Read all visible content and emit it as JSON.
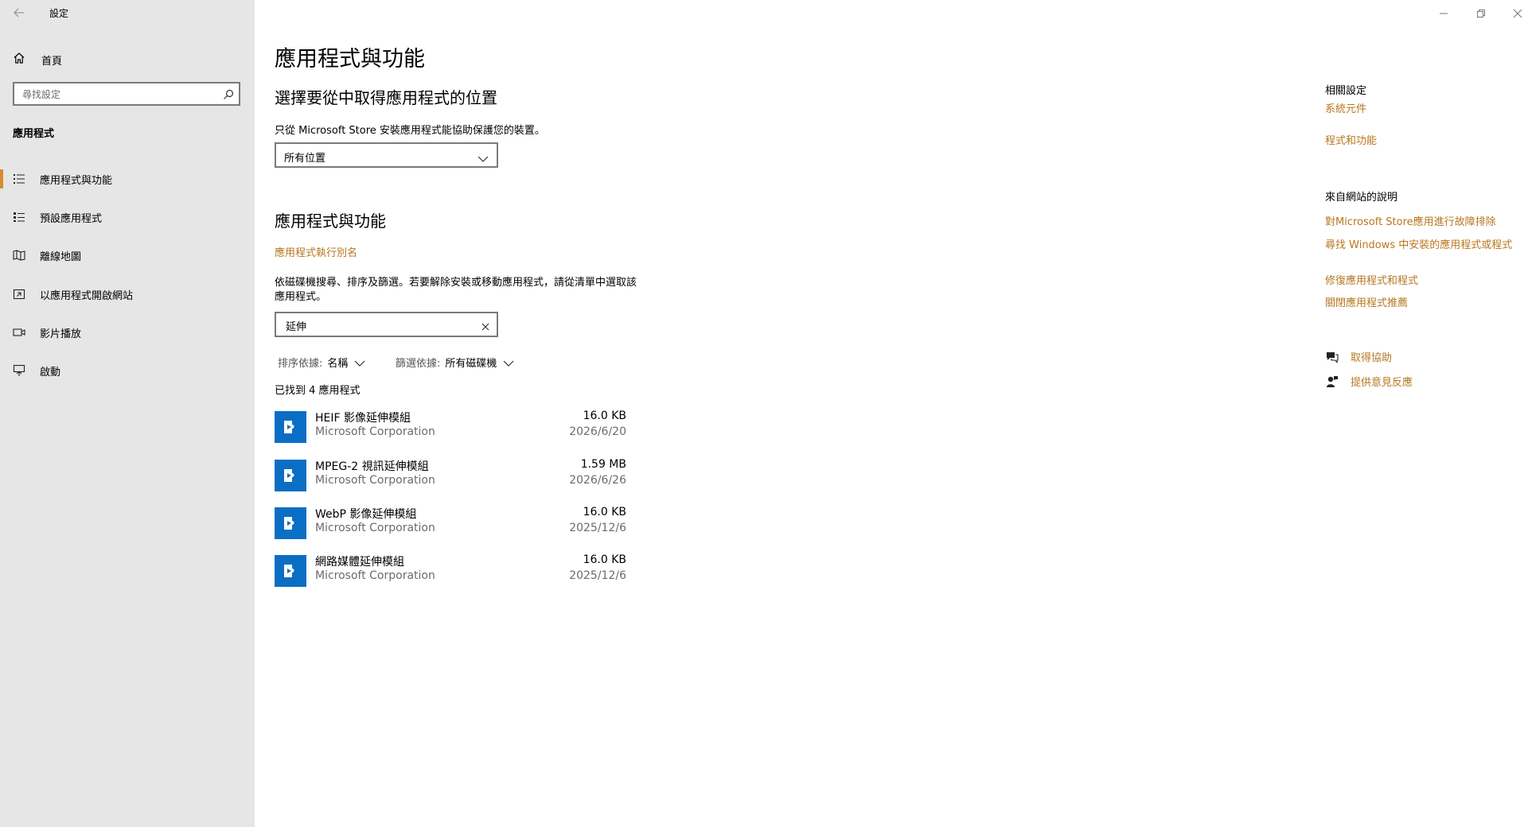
{
  "window": {
    "title": "設定"
  },
  "sidebar": {
    "home_label": "首頁",
    "search_placeholder": "尋找設定",
    "section_label": "應用程式",
    "items": [
      {
        "label": "應用程式與功能",
        "icon": "apps-features-icon",
        "selected": true
      },
      {
        "label": "預設應用程式",
        "icon": "default-apps-icon",
        "selected": false
      },
      {
        "label": "離線地圖",
        "icon": "offline-maps-icon",
        "selected": false
      },
      {
        "label": "以應用程式開啟網站",
        "icon": "apps-for-websites-icon",
        "selected": false
      },
      {
        "label": "影片播放",
        "icon": "video-playback-icon",
        "selected": false
      },
      {
        "label": "啟動",
        "icon": "startup-icon",
        "selected": false
      }
    ]
  },
  "main": {
    "title": "應用程式與功能",
    "install_source_heading": "選擇要從中取得應用程式的位置",
    "install_source_desc": "只從 Microsoft Store 安裝應用程式能協助保護您的裝置。",
    "install_source_value": "所有位置",
    "apps_heading": "應用程式與功能",
    "alias_link": "應用程式執行別名",
    "search_desc": "依磁碟機搜尋、排序及篩選。若要解除安裝或移動應用程式，請從清單中選取該應用程式。",
    "search_value": "延伸",
    "sort_label": "排序依據:",
    "sort_value": "名稱",
    "filter_label": "篩選依據:",
    "filter_value": "所有磁碟機",
    "found_text": "已找到 4 應用程式",
    "apps": [
      {
        "name": "HEIF 影像延伸模組",
        "publisher": "Microsoft Corporation",
        "size": "16.0 KB",
        "date": "2026/6/20"
      },
      {
        "name": "MPEG-2 視訊延伸模組",
        "publisher": "Microsoft Corporation",
        "size": "1.59 MB",
        "date": "2026/6/26"
      },
      {
        "name": "WebP 影像延伸模組",
        "publisher": "Microsoft Corporation",
        "size": "16.0 KB",
        "date": "2025/12/6"
      },
      {
        "name": "網路媒體延伸模組",
        "publisher": "Microsoft Corporation",
        "size": "16.0 KB",
        "date": "2025/12/6"
      }
    ]
  },
  "related": {
    "heading": "相關設定",
    "links": [
      "系統元件",
      "程式和功能"
    ],
    "web_help_heading": "來自網站的說明",
    "web_links": [
      "對Microsoft Store應用進行故障排除",
      "尋找 Windows 中安裝的應用程式或程式",
      "修復應用程式和程式",
      "關閉應用程式推薦"
    ],
    "get_help": "取得協助",
    "feedback": "提供意見反應"
  },
  "colors": {
    "accent": "#d98c2c",
    "link": "#b77720",
    "sidebar_bg": "#e6e6e6",
    "app_tile": "#0b6ec5"
  }
}
